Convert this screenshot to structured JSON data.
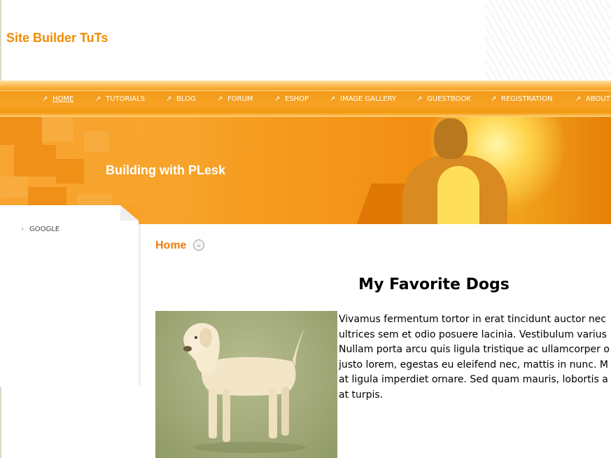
{
  "header": {
    "site_title": "Site Builder TuTs"
  },
  "nav": {
    "items": [
      {
        "label": "HOME"
      },
      {
        "label": "TUTORIALS"
      },
      {
        "label": "BLOG"
      },
      {
        "label": "FORUM"
      },
      {
        "label": "ESHOP"
      },
      {
        "label": "IMAGE GALLERY"
      },
      {
        "label": "GUESTBOOK"
      },
      {
        "label": "REGISTRATION"
      },
      {
        "label": "ABOUT"
      }
    ],
    "active": "HOME",
    "arrow_icon": "north-east-arrow-icon"
  },
  "banner": {
    "title": "Building with PLesk"
  },
  "sidebar": {
    "items": [
      {
        "label": "GOOGLE"
      }
    ]
  },
  "breadcrumb": {
    "home": "Home"
  },
  "content": {
    "heading": "My Favorite Dogs",
    "paragraph_lines": [
      "Vivamus fermentum tortor in erat tincidunt auctor nec",
      "ultrices sem et odio posuere lacinia. Vestibulum varius",
      "Nullam porta arcu quis ligula tristique ac ullamcorper o",
      "justo lorem, egestas eu eleifend nec, mattis in nunc. M",
      "at ligula imperdiet ornare. Sed quam mauris, lobortis a",
      "at turpis."
    ]
  },
  "colors": {
    "brand_orange": "#f08c00",
    "nav_orange": "#f39c1a",
    "breadcrumb_orange": "#ec7d0c"
  }
}
